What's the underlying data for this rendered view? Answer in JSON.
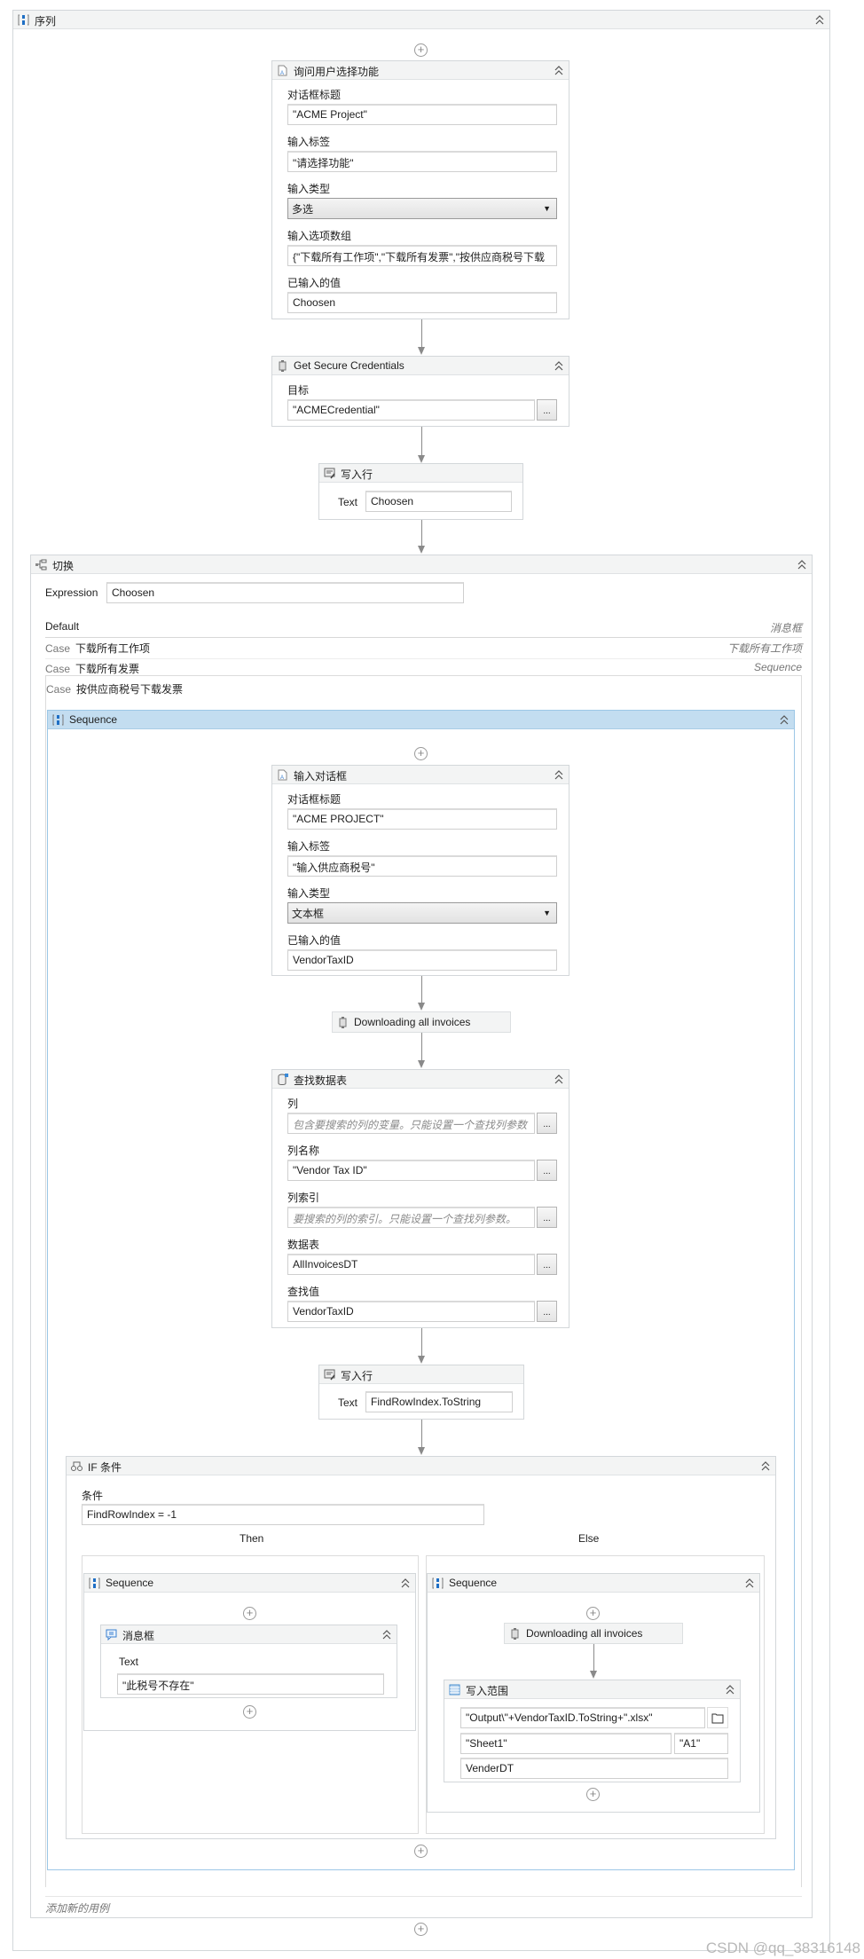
{
  "root": {
    "title": "序列"
  },
  "ask_dialog": {
    "title": "询问用户选择功能",
    "fields": [
      {
        "label": "对话框标题",
        "value": "\"ACME Project\""
      },
      {
        "label": "输入标签",
        "value": "\"请选择功能\""
      },
      {
        "label": "输入类型",
        "value": "多选"
      },
      {
        "label": "输入选项数组",
        "value": "{\"下载所有工作项\",\"下载所有发票\",\"按供应商税号下载"
      },
      {
        "label": "已输入的值",
        "value": "Choosen"
      }
    ]
  },
  "credentials": {
    "title": "Get Secure Credentials",
    "target_label": "目标",
    "target_value": "\"ACMECredential\"",
    "browse": "..."
  },
  "writeline1": {
    "title": "写入行",
    "text_label": "Text",
    "text_value": "Choosen"
  },
  "switch": {
    "title": "切换",
    "expression_label": "Expression",
    "expression_value": "Choosen",
    "default_label": "Default",
    "default_activity": "消息框",
    "case_keyword": "Case",
    "cases": [
      {
        "value": "下载所有工作项",
        "activity": "下载所有工作项"
      },
      {
        "value": "下载所有发票",
        "activity": "Sequence"
      },
      {
        "value": "按供应商税号下载发票"
      }
    ],
    "add_case": "添加新的用例"
  },
  "sequence": {
    "title": "Sequence"
  },
  "input_dialog": {
    "title": "输入对话框",
    "fields": [
      {
        "label": "对话框标题",
        "value": "\"ACME PROJECT\""
      },
      {
        "label": "输入标签",
        "value": "\"输入供应商税号\""
      },
      {
        "label": "输入类型",
        "value": "文本框"
      },
      {
        "label": "已输入的值",
        "value": "VendorTaxID"
      }
    ]
  },
  "download1": {
    "title": "Downloading all invoices"
  },
  "lookup": {
    "title": "查找数据表",
    "fields": [
      {
        "label": "列",
        "placeholder": "包含要搜索的列的变量。只能设置一个查找列参数"
      },
      {
        "label": "列名称",
        "value": "\"Vendor Tax ID\""
      },
      {
        "label": "列索引",
        "placeholder": "要搜索的列的索引。只能设置一个查找列参数。"
      },
      {
        "label": "数据表",
        "value": "AllInvoicesDT"
      },
      {
        "label": "查找值",
        "value": "VendorTaxID"
      }
    ],
    "browse": "..."
  },
  "writeline2": {
    "title": "写入行",
    "text_label": "Text",
    "text_value": "FindRowIndex.ToString"
  },
  "if": {
    "title": "IF 条件",
    "condition_label": "条件",
    "condition_value": "FindRowIndex = -1",
    "then_label": "Then",
    "else_label": "Else"
  },
  "then_seq": {
    "title": "Sequence",
    "msgbox": {
      "title": "消息框",
      "text_label": "Text",
      "text_value": "\"此税号不存在\""
    }
  },
  "else_seq": {
    "title": "Sequence",
    "download": "Downloading all invoices",
    "write_range": {
      "title": "写入范围",
      "path": "\"Output\\\"+VendorTaxID.ToString+\".xlsx\"",
      "sheet": "\"Sheet1\"",
      "cell": "\"A1\"",
      "datatable": "VenderDT"
    }
  },
  "watermark": "CSDN @qq_38316148"
}
